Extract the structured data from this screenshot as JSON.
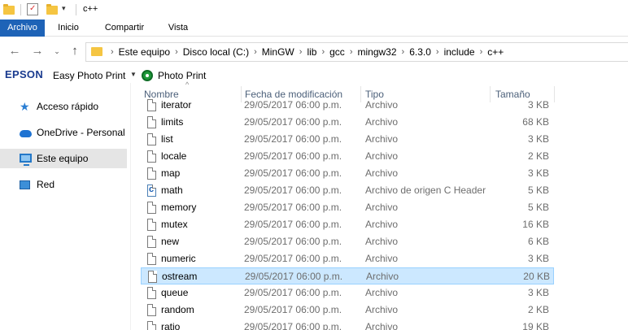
{
  "window": {
    "title": "c++"
  },
  "ribbon": {
    "tabs": [
      "Archivo",
      "Inicio",
      "Compartir",
      "Vista"
    ]
  },
  "address": {
    "crumbs": [
      "Este equipo",
      "Disco local (C:)",
      "MinGW",
      "lib",
      "gcc",
      "mingw32",
      "6.3.0",
      "include",
      "c++"
    ]
  },
  "toolbar": {
    "brand": "EPSON",
    "easy_photo_print": "Easy Photo Print",
    "photo_print": "Photo Print"
  },
  "navpane": {
    "items": [
      {
        "label": "Acceso rápido",
        "icon": "star-icon"
      },
      {
        "label": "OneDrive - Personal",
        "icon": "cloud-icon"
      },
      {
        "label": "Este equipo",
        "icon": "computer-icon"
      },
      {
        "label": "Red",
        "icon": "network-icon"
      }
    ]
  },
  "columns": {
    "name": "Nombre",
    "date": "Fecha de modificación",
    "type": "Tipo",
    "size": "Tamaño"
  },
  "files": [
    {
      "name": "iterator",
      "date": "29/05/2017 06:00 p.m.",
      "type": "Archivo",
      "size": "3 KB",
      "icon": "file-icon"
    },
    {
      "name": "limits",
      "date": "29/05/2017 06:00 p.m.",
      "type": "Archivo",
      "size": "68 KB",
      "icon": "file-icon"
    },
    {
      "name": "list",
      "date": "29/05/2017 06:00 p.m.",
      "type": "Archivo",
      "size": "3 KB",
      "icon": "file-icon"
    },
    {
      "name": "locale",
      "date": "29/05/2017 06:00 p.m.",
      "type": "Archivo",
      "size": "2 KB",
      "icon": "file-icon"
    },
    {
      "name": "map",
      "date": "29/05/2017 06:00 p.m.",
      "type": "Archivo",
      "size": "3 KB",
      "icon": "file-icon"
    },
    {
      "name": "math",
      "date": "29/05/2017 06:00 p.m.",
      "type": "Archivo de origen C Header",
      "size": "5 KB",
      "icon": "c-header-icon"
    },
    {
      "name": "memory",
      "date": "29/05/2017 06:00 p.m.",
      "type": "Archivo",
      "size": "5 KB",
      "icon": "file-icon"
    },
    {
      "name": "mutex",
      "date": "29/05/2017 06:00 p.m.",
      "type": "Archivo",
      "size": "16 KB",
      "icon": "file-icon"
    },
    {
      "name": "new",
      "date": "29/05/2017 06:00 p.m.",
      "type": "Archivo",
      "size": "6 KB",
      "icon": "file-icon"
    },
    {
      "name": "numeric",
      "date": "29/05/2017 06:00 p.m.",
      "type": "Archivo",
      "size": "3 KB",
      "icon": "file-icon"
    },
    {
      "name": "ostream",
      "date": "29/05/2017 06:00 p.m.",
      "type": "Archivo",
      "size": "20 KB",
      "icon": "file-icon",
      "selected": true
    },
    {
      "name": "queue",
      "date": "29/05/2017 06:00 p.m.",
      "type": "Archivo",
      "size": "3 KB",
      "icon": "file-icon"
    },
    {
      "name": "random",
      "date": "29/05/2017 06:00 p.m.",
      "type": "Archivo",
      "size": "2 KB",
      "icon": "file-icon"
    },
    {
      "name": "ratio",
      "date": "29/05/2017 06:00 p.m.",
      "type": "Archivo",
      "size": "19 KB",
      "icon": "file-icon"
    }
  ],
  "colors": {
    "ribbon_file_tab": "#1e63b7",
    "selection_fill": "#cce8ff",
    "selection_border": "#99d1ff",
    "header_text": "#4c607a"
  }
}
